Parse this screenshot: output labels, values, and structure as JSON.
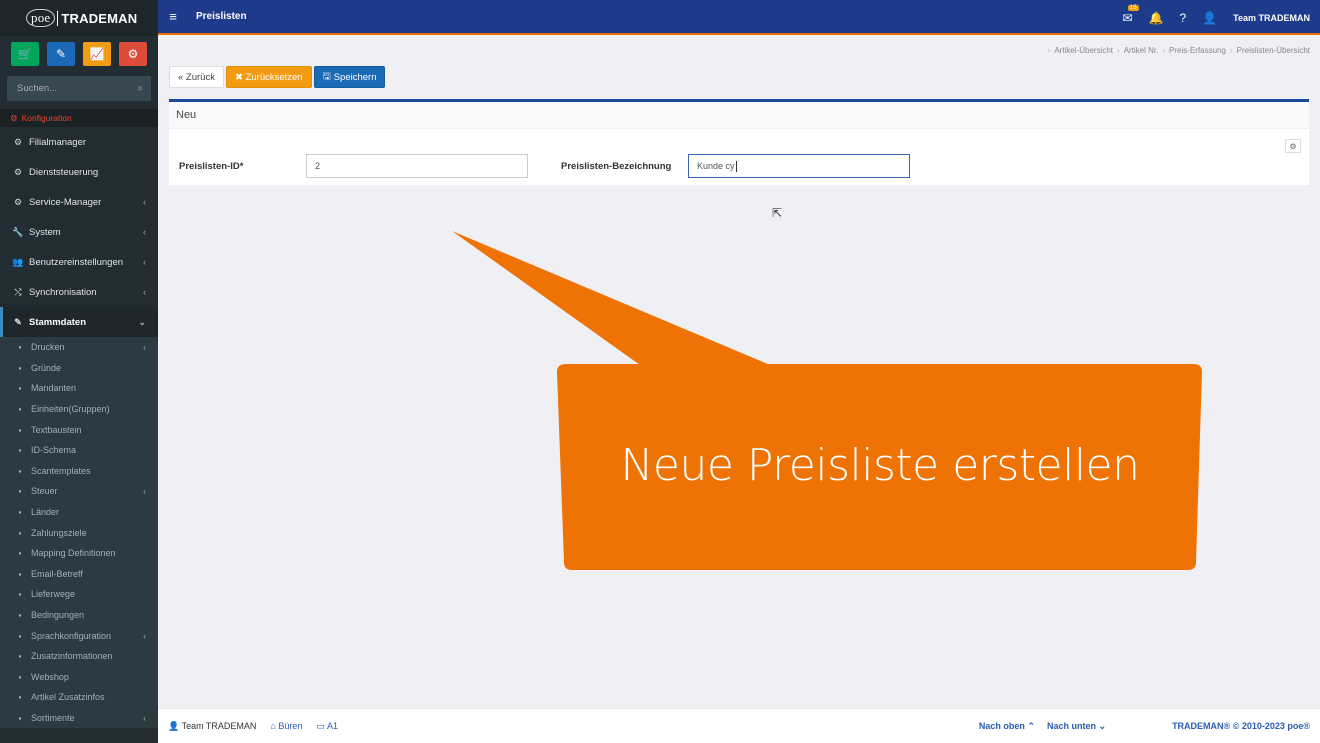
{
  "app": {
    "logo_poe": "poe",
    "logo_brand": "TRADEMAN"
  },
  "sidebar": {
    "search_placeholder": "Suchen...",
    "section_header": "Konfiguration",
    "items": [
      {
        "label": "Filialmanager",
        "icon": "cogs-icon",
        "has_chevron": false
      },
      {
        "label": "Dienststeuerung",
        "icon": "gear-icon",
        "has_chevron": false
      },
      {
        "label": "Service-Manager",
        "icon": "cogs-icon",
        "has_chevron": true
      },
      {
        "label": "System",
        "icon": "wrench-icon",
        "has_chevron": true
      },
      {
        "label": "Benutzereinstellungen",
        "icon": "users-icon",
        "has_chevron": true
      },
      {
        "label": "Synchronisation",
        "icon": "shuffle-icon",
        "has_chevron": true
      },
      {
        "label": "Stammdaten",
        "icon": "pencil-icon",
        "has_chevron": true,
        "active": true
      }
    ],
    "subitems": [
      {
        "label": "Drucken",
        "chev": true
      },
      {
        "label": "Gründe"
      },
      {
        "label": "Mandanten"
      },
      {
        "label": "Einheiten(Gruppen)"
      },
      {
        "label": "Textbaustein"
      },
      {
        "label": "ID-Schema"
      },
      {
        "label": "Scantemplates"
      },
      {
        "label": "Steuer",
        "chev": true
      },
      {
        "label": "Länder"
      },
      {
        "label": "Zahlungsziele"
      },
      {
        "label": "Mapping Definitionen"
      },
      {
        "label": "Email-Betreff"
      },
      {
        "label": "Lieferwege"
      },
      {
        "label": "Bedingungen"
      },
      {
        "label": "Sprachkonfiguration",
        "chev": true
      },
      {
        "label": "Zusatzinformationen"
      },
      {
        "label": "Webshop"
      },
      {
        "label": "Artikel Zusatzinfos"
      },
      {
        "label": "Sortimente",
        "chev": true
      }
    ]
  },
  "topbar": {
    "title": "Preislisten",
    "mail_badge": "15",
    "user": "Team TRADEMAN"
  },
  "breadcrumb": [
    "Artikel-Übersicht",
    "Artikel Nr.",
    "Preis-Erfassung",
    "Preislisten-Übersicht"
  ],
  "toolbar": {
    "back": "« Zurück",
    "reset": "✖ Zurücksetzen",
    "save": "Speichern"
  },
  "panel": {
    "title": "Neu",
    "id_label": "Preislisten-ID*",
    "id_value": "2",
    "name_label": "Preislisten-Bezeichnung",
    "name_value": "Kunde cy"
  },
  "callout": {
    "text": "Neue Preisliste erstellen",
    "color": "#ef7205"
  },
  "footer": {
    "user": "Team TRADEMAN",
    "location": "Büren",
    "terminal": "A1",
    "up": "Nach oben",
    "down": "Nach unten",
    "copyright": "TRADEMAN® © 2010-2023 poe®"
  }
}
